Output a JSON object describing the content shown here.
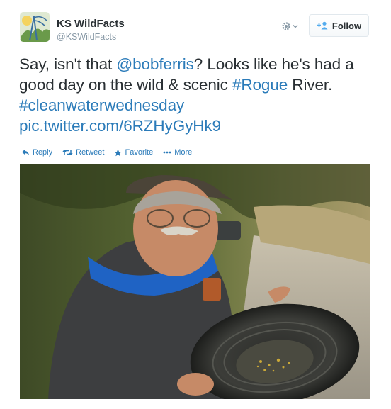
{
  "account": {
    "name": "KS WildFacts",
    "handle": "@KSWildFacts"
  },
  "follow_label": "Follow",
  "tweet": {
    "part1": "Say, isn't that ",
    "mention": "@bobferris",
    "part2": "? Looks like he's had a good day on the wild & scenic ",
    "hashtag1": "#Rogue",
    "part3": " River. ",
    "hashtag2": "#cleanwaterwednesday",
    "part4": " ",
    "link": "pic.twitter.com/6RZHyGyHk9"
  },
  "actions": {
    "reply": "Reply",
    "retweet": "Retweet",
    "favorite": "Favorite",
    "more": "More"
  },
  "colors": {
    "link": "#2b7bb9",
    "text": "#292f33",
    "muted": "#8899a6"
  },
  "icons": [
    "gear-icon",
    "chevron-down-icon",
    "follow-person-icon",
    "reply-icon",
    "retweet-icon",
    "favorite-star-icon",
    "more-dots-icon"
  ]
}
